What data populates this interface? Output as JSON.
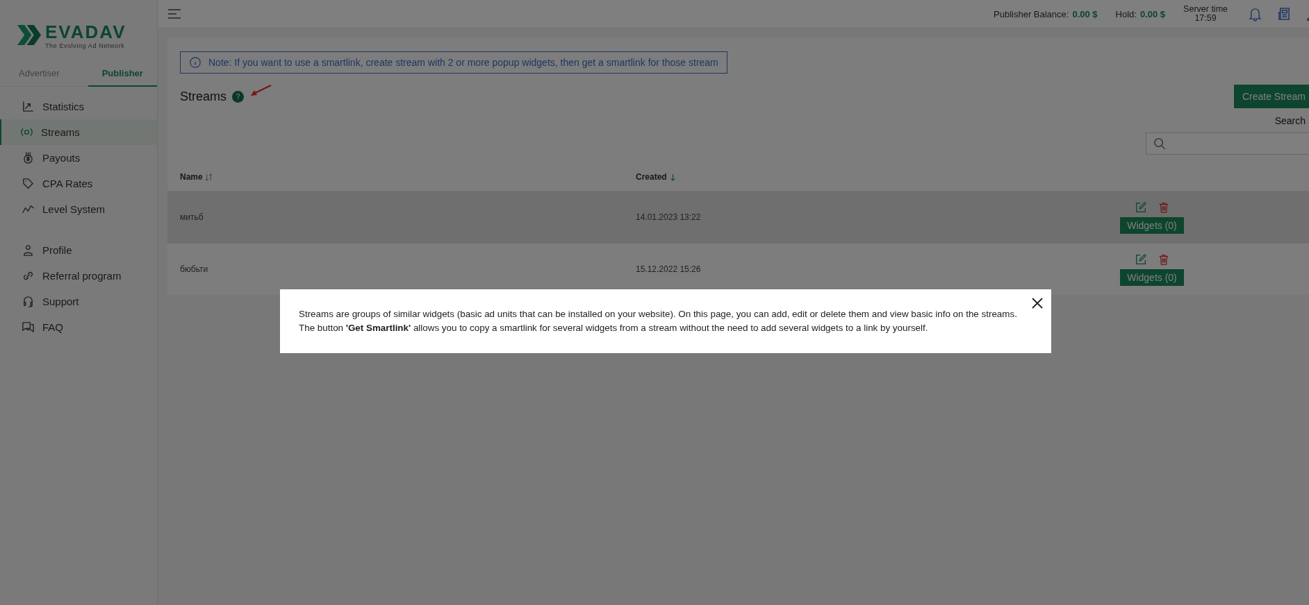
{
  "logo": {
    "name": "EVADAV",
    "tagline": "The Evolving Ad Network"
  },
  "role_tabs": [
    {
      "label": "Advertiser",
      "selected": false
    },
    {
      "label": "Publisher",
      "selected": true
    }
  ],
  "nav_groups": [
    [
      {
        "label": "Statistics",
        "selected": false
      },
      {
        "label": "Streams",
        "selected": true
      },
      {
        "label": "Payouts",
        "selected": false
      },
      {
        "label": "CPA Rates",
        "selected": false
      },
      {
        "label": "Level System",
        "selected": false
      }
    ],
    [
      {
        "label": "Profile",
        "selected": false
      },
      {
        "label": "Referral program",
        "selected": false
      },
      {
        "label": "Support",
        "selected": false
      },
      {
        "label": "FAQ",
        "selected": false
      }
    ]
  ],
  "header": {
    "balance_label": "Publisher Balance:",
    "balance_value": "0.00 $",
    "hold_label": "Hold:",
    "hold_value": "0.00 $",
    "server_time_label": "Server time",
    "server_time": "17:59"
  },
  "note": "Note: If you want to use a smartlink, create stream with 2 or more popup widgets, then get a smartlink for those stream",
  "page_title": "Streams",
  "help_badge": "?",
  "create_button": "Create Stream",
  "search_label": "Search",
  "table": {
    "columns": [
      {
        "label": "Name",
        "sorted": false
      },
      {
        "label": "Created",
        "sorted": true
      }
    ],
    "rows": [
      {
        "name": "митьб",
        "created": "14.01.2023 13:22",
        "widgets_button": "Widgets (0)",
        "highlighted": true
      },
      {
        "name": "бюбьти",
        "created": "15.12.2022 15:26",
        "widgets_button": "Widgets (0)",
        "highlighted": false
      }
    ]
  },
  "modal": {
    "text": "Streams are groups of similar widgets (basic ad units that can be installed on your website). On this page, you can add, edit or delete them and view basic info on the streams. The button **'Get Smartlink'** allows you to copy a smartlink for several widgets from a stream without the need to add several widgets to a link by yourself."
  }
}
